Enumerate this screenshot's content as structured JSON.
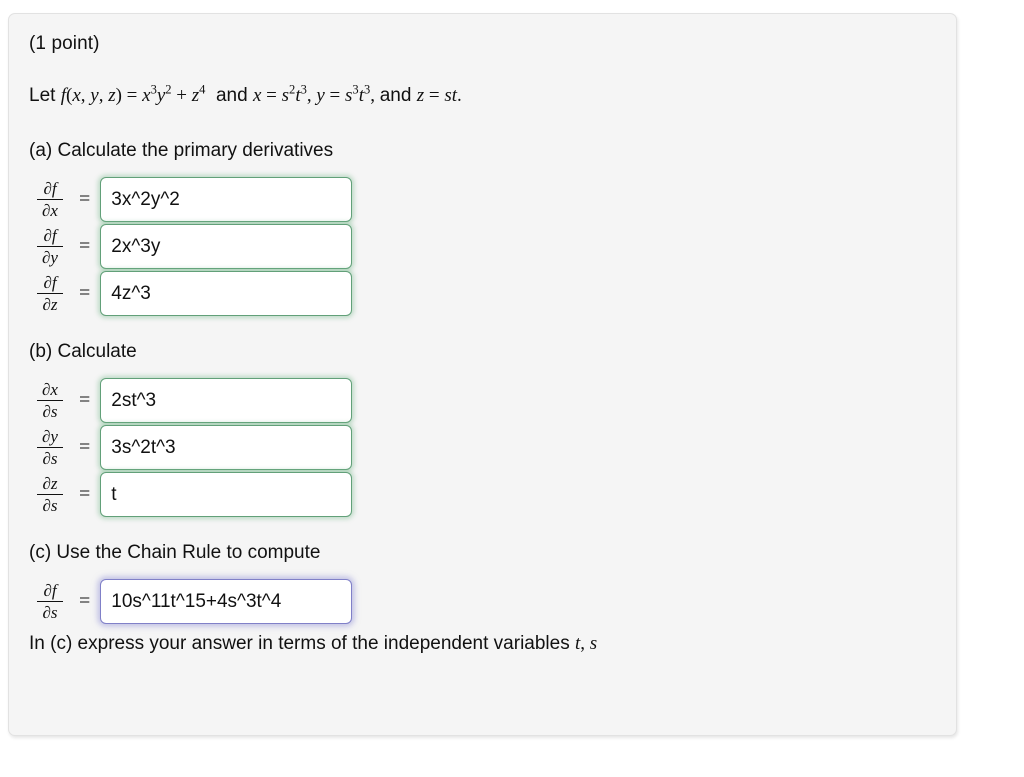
{
  "panel": {
    "points_label": "(1 point)",
    "background_color": "#f5f5f5",
    "border_color": "#e2e2e2"
  },
  "problem": {
    "statement_plain": "Let f(x, y, z) = x^3 y^2 + z^4 and x = s^2 t^3, y = s^3 t^3, and z = st."
  },
  "sections": [
    {
      "id": "a",
      "heading": "(a) Calculate the primary derivatives",
      "rows": [
        {
          "numerator": "∂f",
          "denominator": "∂x",
          "equals": "=",
          "value": "3x^2y^2",
          "state": "correct"
        },
        {
          "numerator": "∂f",
          "denominator": "∂y",
          "equals": "=",
          "value": "2x^3y",
          "state": "correct"
        },
        {
          "numerator": "∂f",
          "denominator": "∂z",
          "equals": "=",
          "value": "4z^3",
          "state": "correct"
        }
      ]
    },
    {
      "id": "b",
      "heading": "(b) Calculate",
      "rows": [
        {
          "numerator": "∂x",
          "denominator": "∂s",
          "equals": "=",
          "value": "2st^3",
          "state": "correct"
        },
        {
          "numerator": "∂y",
          "denominator": "∂s",
          "equals": "=",
          "value": "3s^2t^3",
          "state": "correct"
        },
        {
          "numerator": "∂z",
          "denominator": "∂s",
          "equals": "=",
          "value": "t",
          "state": "correct"
        }
      ]
    },
    {
      "id": "c",
      "heading": "(c) Use the Chain Rule to compute",
      "rows": [
        {
          "numerator": "∂f",
          "denominator": "∂s",
          "equals": "=",
          "value": "10s^11t^15+4s^3t^4",
          "state": "focused"
        }
      ]
    }
  ],
  "closing_note": {
    "prefix": "In (c) express your answer in terms of the independent variables ",
    "var1": "t",
    "separator": ", ",
    "var2": "s"
  },
  "colors": {
    "correct_border": "#62a079",
    "focused_border": "#8080c8",
    "text": "#111111",
    "panel_bg": "#f5f5f5"
  }
}
